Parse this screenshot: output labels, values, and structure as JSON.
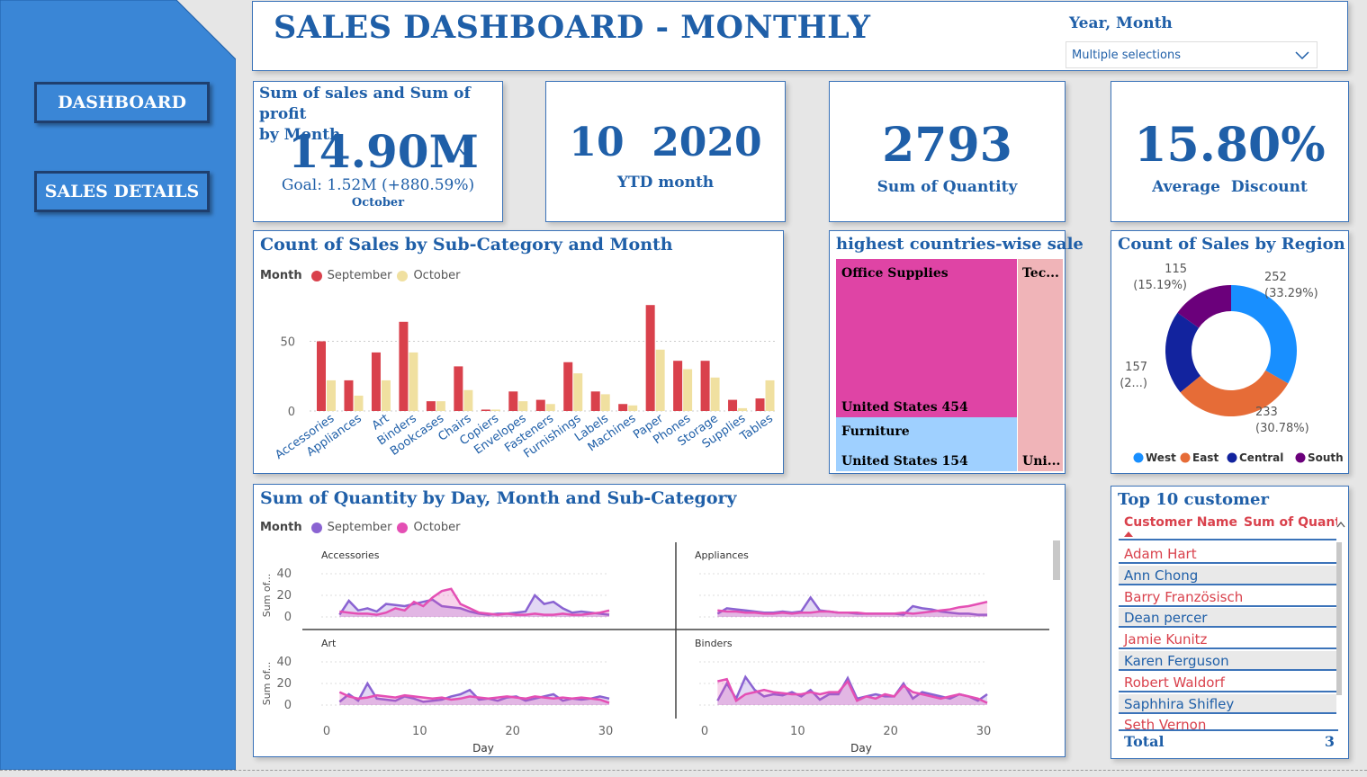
{
  "nav": {
    "dashboard_label": "DASHBOARD",
    "sales_details_label": "SALES DETAILS"
  },
  "header": {
    "title": "SALES DASHBOARD - MONTHLY",
    "filter_label": "Year, Month",
    "filter_value": "Multiple selections"
  },
  "kpi_sales": {
    "title_line1": "Sum of sales and Sum of profit",
    "title_line2": "by Month",
    "value": "14.90M",
    "goal": "Goal: 1.52M (+880.59%)",
    "month": "October"
  },
  "kpi_ytd": {
    "value": "10  2020",
    "label": "YTD month"
  },
  "kpi_qty": {
    "value": "2793",
    "label": "Sum of Quantity"
  },
  "kpi_discount": {
    "value": "15.80%",
    "label": "Average  Discount"
  },
  "bar_chart": {
    "title": "Count of Sales by Sub-Category and Month",
    "legend_title": "Month",
    "series_names": [
      "September",
      "October"
    ],
    "colors": [
      "#d9414c",
      "#f0e0a0"
    ]
  },
  "treemap": {
    "title": "highest countries-wise sale",
    "tiles": [
      {
        "category": "Office Supplies",
        "label": "United States 454",
        "color": "#df44a5"
      },
      {
        "category": "Furniture",
        "label": "United States 154",
        "color": "#9fd0ff"
      },
      {
        "category": "Tec...",
        "label": "Uni...",
        "color": "#f0b4b8"
      }
    ]
  },
  "donut": {
    "title": "Count of Sales by Region",
    "slices": [
      {
        "name": "West",
        "value": 252,
        "pct": "(33.29%)",
        "color": "#188fff"
      },
      {
        "name": "East",
        "value": 233,
        "pct": "(30.78%)",
        "color": "#e66c37"
      },
      {
        "name": "Central",
        "value": 157,
        "pct": "(2...)",
        "color": "#12239e"
      },
      {
        "name": "South",
        "value": 115,
        "pct": "(15.19%)",
        "color": "#6b007b"
      }
    ]
  },
  "line_chart": {
    "title": "Sum of Quantity by Day, Month and Sub-Category",
    "legend_title": "Month",
    "series_names": [
      "September",
      "October"
    ],
    "colors": [
      "#8a63d2",
      "#e44fb4"
    ],
    "ylabel": "Sum of...",
    "xlabel": "Day",
    "y_ticks": [
      "40",
      "20",
      "0"
    ],
    "x_ticks": [
      "0",
      "10",
      "20",
      "30"
    ],
    "panels": [
      "Accessories",
      "Appliances",
      "Art",
      "Binders"
    ]
  },
  "top_customers": {
    "title": "Top 10 customer",
    "col1": "Customer Name",
    "col2": "Sum of Quant",
    "rows": [
      "Adam Hart",
      "Ann Chong",
      "Barry Französisch",
      "Dean percer",
      "Jamie Kunitz",
      "Karen Ferguson",
      "Robert Waldorf",
      "Saphhira Shifley",
      "Seth Vernon"
    ],
    "total_label": "Total",
    "total_value": "3"
  },
  "chart_data": [
    {
      "type": "bar",
      "title": "Count of Sales by Sub-Category and Month",
      "categories": [
        "Accessories",
        "Appliances",
        "Art",
        "Binders",
        "Bookcases",
        "Chairs",
        "Copiers",
        "Envelopes",
        "Fasteners",
        "Furnishings",
        "Labels",
        "Machines",
        "Paper",
        "Phones",
        "Storage",
        "Supplies",
        "Tables"
      ],
      "series": [
        {
          "name": "September",
          "values": [
            50,
            22,
            42,
            64,
            7,
            32,
            1,
            14,
            8,
            35,
            14,
            5,
            76,
            36,
            36,
            8,
            9
          ]
        },
        {
          "name": "October",
          "values": [
            22,
            11,
            22,
            42,
            7,
            15,
            1,
            7,
            5,
            27,
            12,
            4,
            44,
            30,
            24,
            2,
            22
          ]
        }
      ],
      "y_ticks": [
        0,
        50
      ],
      "ylim": [
        0,
        80
      ],
      "grid": true,
      "legend": "top-left"
    },
    {
      "type": "pie",
      "title": "Count of Sales by Region",
      "categories": [
        "West",
        "East",
        "Central",
        "South"
      ],
      "values": [
        252,
        233,
        157,
        115
      ],
      "legend": "bottom"
    },
    {
      "type": "area",
      "title": "Sum of Quantity by Day, Month and Sub-Category",
      "xlabel": "Day",
      "xlim": [
        0,
        30
      ],
      "ylim": [
        0,
        40
      ],
      "panels": [
        {
          "name": "Accessories",
          "series": [
            {
              "name": "September",
              "x": [
                1,
                2,
                3,
                4,
                5,
                6,
                7,
                8,
                9,
                10,
                11,
                12,
                13,
                14,
                15,
                16,
                17,
                18,
                19,
                20,
                21,
                22,
                23,
                24,
                25,
                26,
                27,
                28,
                29,
                30
              ],
              "values": [
                2,
                15,
                6,
                8,
                5,
                12,
                11,
                10,
                12,
                14,
                16,
                10,
                9,
                8,
                5,
                3,
                2,
                3,
                3,
                4,
                5,
                20,
                12,
                14,
                8,
                4,
                5,
                4,
                3,
                2
              ]
            },
            {
              "name": "October",
              "x": [
                1,
                2,
                3,
                4,
                5,
                6,
                7,
                8,
                9,
                10,
                11,
                12,
                13,
                14,
                15,
                16,
                17,
                18,
                19,
                20,
                21,
                22,
                23,
                24,
                25,
                26,
                27,
                28,
                29,
                30
              ],
              "values": [
                5,
                4,
                3,
                3,
                2,
                4,
                8,
                6,
                14,
                10,
                18,
                24,
                26,
                12,
                8,
                4,
                3,
                2,
                3,
                2,
                2,
                3,
                2,
                2,
                3,
                2,
                2,
                3,
                4,
                6
              ]
            }
          ]
        },
        {
          "name": "Appliances",
          "series": [
            {
              "name": "September",
              "x": [
                1,
                2,
                3,
                4,
                5,
                6,
                7,
                8,
                9,
                10,
                11,
                12,
                13,
                14,
                15,
                16,
                17,
                18,
                19,
                20,
                21,
                22,
                23,
                24,
                25,
                26,
                27,
                28,
                29,
                30
              ],
              "values": [
                3,
                8,
                7,
                6,
                5,
                4,
                4,
                5,
                4,
                5,
                18,
                6,
                5,
                4,
                4,
                3,
                3,
                3,
                3,
                3,
                2,
                10,
                8,
                7,
                5,
                4,
                3,
                3,
                2,
                2
              ]
            },
            {
              "name": "October",
              "x": [
                1,
                2,
                3,
                4,
                5,
                6,
                7,
                8,
                9,
                10,
                11,
                12,
                13,
                14,
                15,
                16,
                17,
                18,
                19,
                20,
                21,
                22,
                23,
                24,
                25,
                26,
                27,
                28,
                29,
                30
              ],
              "values": [
                6,
                5,
                5,
                4,
                4,
                3,
                3,
                4,
                3,
                4,
                4,
                5,
                5,
                4,
                4,
                4,
                3,
                3,
                3,
                3,
                4,
                3,
                4,
                5,
                6,
                7,
                9,
                10,
                12,
                14
              ]
            }
          ]
        },
        {
          "name": "Art",
          "series": [
            {
              "name": "September",
              "x": [
                1,
                2,
                3,
                4,
                5,
                6,
                7,
                8,
                9,
                10,
                11,
                12,
                13,
                14,
                15,
                16,
                17,
                18,
                19,
                20,
                21,
                22,
                23,
                24,
                25,
                26,
                27,
                28,
                29,
                30
              ],
              "values": [
                3,
                10,
                4,
                20,
                6,
                5,
                4,
                8,
                6,
                3,
                4,
                5,
                8,
                10,
                14,
                5,
                6,
                4,
                7,
                8,
                4,
                6,
                8,
                10,
                4,
                6,
                5,
                6,
                8,
                6
              ]
            },
            {
              "name": "October",
              "x": [
                1,
                2,
                3,
                4,
                5,
                6,
                7,
                8,
                9,
                10,
                11,
                12,
                13,
                14,
                15,
                16,
                17,
                18,
                19,
                20,
                21,
                22,
                23,
                24,
                25,
                26,
                27,
                28,
                29,
                30
              ],
              "values": [
                12,
                8,
                6,
                7,
                9,
                8,
                7,
                9,
                8,
                7,
                6,
                7,
                5,
                6,
                8,
                7,
                6,
                7,
                8,
                7,
                6,
                8,
                7,
                6,
                7,
                6,
                7,
                6,
                5,
                2
              ]
            }
          ]
        },
        {
          "name": "Binders",
          "series": [
            {
              "name": "September",
              "x": [
                1,
                2,
                3,
                4,
                5,
                6,
                7,
                8,
                9,
                10,
                11,
                12,
                13,
                14,
                15,
                16,
                17,
                18,
                19,
                20,
                21,
                22,
                23,
                24,
                25,
                26,
                27,
                28,
                29,
                30
              ],
              "values": [
                4,
                20,
                6,
                26,
                14,
                8,
                10,
                9,
                12,
                8,
                14,
                5,
                10,
                10,
                25,
                6,
                8,
                10,
                8,
                8,
                20,
                6,
                12,
                10,
                8,
                6,
                10,
                8,
                4,
                10
              ]
            },
            {
              "name": "October",
              "x": [
                1,
                2,
                3,
                4,
                5,
                6,
                7,
                8,
                9,
                10,
                11,
                12,
                13,
                14,
                15,
                16,
                17,
                18,
                19,
                20,
                21,
                22,
                23,
                24,
                25,
                26,
                27,
                28,
                29,
                30
              ],
              "values": [
                22,
                24,
                4,
                10,
                12,
                14,
                12,
                11,
                10,
                10,
                12,
                10,
                12,
                12,
                22,
                4,
                8,
                6,
                10,
                8,
                18,
                12,
                10,
                8,
                6,
                8,
                10,
                8,
                6,
                2
              ]
            }
          ]
        }
      ]
    }
  ]
}
